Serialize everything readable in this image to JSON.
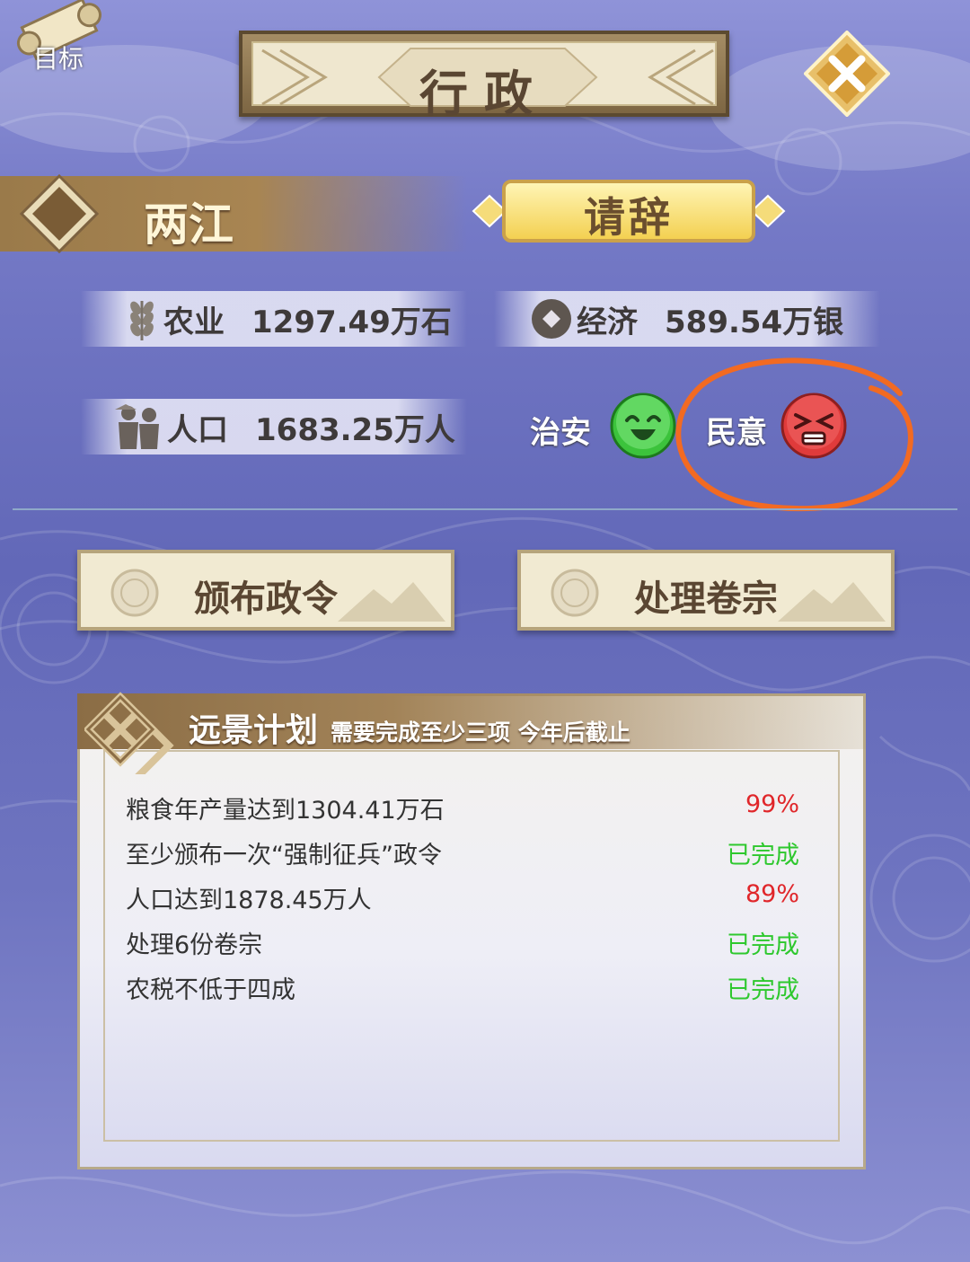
{
  "header": {
    "goal_label": "目标",
    "title": "行政"
  },
  "region": {
    "name": "两江",
    "resign_label": "请辞"
  },
  "stats": {
    "agriculture": {
      "label": "农业",
      "value": "1297.49万石"
    },
    "economy": {
      "label": "经济",
      "value": "589.54万银"
    },
    "population": {
      "label": "人口",
      "value": "1683.25万人"
    },
    "security": {
      "label": "治安",
      "status": "happy",
      "color": "#3cc33c"
    },
    "opinion": {
      "label": "民意",
      "status": "angry",
      "color": "#e03b3b"
    }
  },
  "actions": {
    "edict_label": "颁布政令",
    "cases_label": "处理卷宗"
  },
  "plan": {
    "title": "远景计划",
    "subtitle": "需要完成至少三项 今年后截止",
    "tasks": [
      {
        "text": "粮食年产量达到1304.41万石",
        "status": "99%",
        "state": "progress"
      },
      {
        "text": "至少颁布一次“强制征兵”政令",
        "status": "已完成",
        "state": "done"
      },
      {
        "text": "人口达到1878.45万人",
        "status": "89%",
        "state": "progress"
      },
      {
        "text": "处理6份卷宗",
        "status": "已完成",
        "state": "done"
      },
      {
        "text": "农税不低于四成",
        "status": "已完成",
        "state": "done"
      }
    ]
  },
  "colors": {
    "progress": "#e0262a",
    "done": "#2ec82e",
    "annotation": "#f26a22"
  }
}
